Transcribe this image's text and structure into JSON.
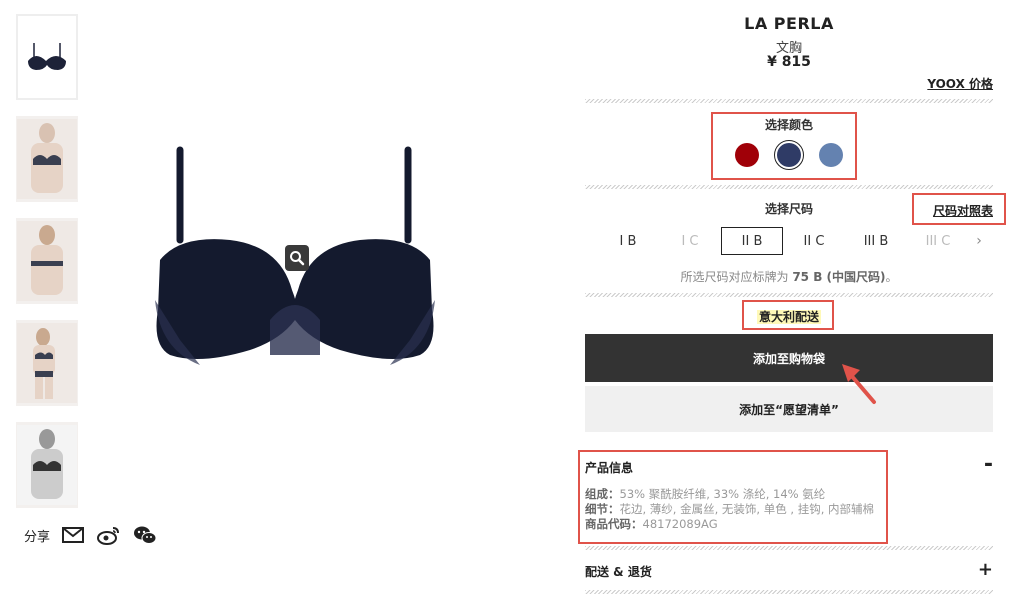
{
  "product": {
    "brand": "LA PERLA",
    "category": "文胸",
    "price": "¥ 815",
    "yoox_price_link": "YOOX 价格"
  },
  "gallery": {
    "thumbnails": [
      "thumb-1",
      "thumb-2",
      "thumb-3",
      "thumb-4",
      "thumb-5"
    ],
    "active_index": 0,
    "zoom_icon": "magnifier-icon"
  },
  "share": {
    "label": "分享",
    "icons": [
      "mail-icon",
      "weibo-icon",
      "wechat-icon"
    ]
  },
  "color_select": {
    "label": "选择颜色",
    "swatches": [
      {
        "color": "#a00008",
        "selected": false
      },
      {
        "color": "#2f3b66",
        "selected": true
      },
      {
        "color": "#6482b0",
        "selected": false
      }
    ]
  },
  "size_select": {
    "label": "选择尺码",
    "size_chart_link": "尺码对照表",
    "sizes": [
      {
        "label": "I B",
        "state": "available"
      },
      {
        "label": "I C",
        "state": "disabled"
      },
      {
        "label": "II B",
        "state": "selected"
      },
      {
        "label": "II C",
        "state": "available"
      },
      {
        "label": "III B",
        "state": "available"
      },
      {
        "label": "III C",
        "state": "disabled"
      }
    ],
    "note_prefix": "所选尺码对应标牌为",
    "note_size": "75 B (中国尺码)",
    "note_suffix": "。"
  },
  "shipping_origin": "意大利配送",
  "actions": {
    "add_to_bag": "添加至购物袋",
    "add_to_wishlist": "添加至“愿望清单”"
  },
  "product_info": {
    "title": "产品信息",
    "toggle": "-",
    "composition_label": "组成：",
    "composition_value": "53% 聚酰胺纤维, 33% 涤纶, 14% 氨纶",
    "details_label": "细节：",
    "details_value": "花边, 薄纱, 金属丝, 无装饰, 单色 , 挂钩, 内部辅棉",
    "code_label": "商品代码：",
    "code_value": "48172089AG"
  },
  "delivery_returns": {
    "title": "配送 & 退货",
    "toggle": "+"
  },
  "colors": {
    "annotation": "#e0534a",
    "button_dark": "#333333",
    "button_light": "#f0f0f0"
  }
}
